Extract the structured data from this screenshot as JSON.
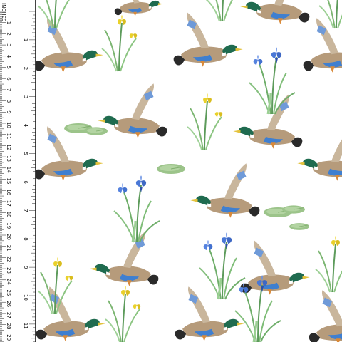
{
  "ruler": {
    "unit_label": "INCHES",
    "inch_labels": [
      "1",
      "2",
      "3",
      "4",
      "5",
      "6",
      "7",
      "8",
      "9",
      "10",
      "11",
      "12"
    ],
    "cm_labels": [
      "1",
      "2",
      "3",
      "4",
      "5",
      "6",
      "7",
      "8",
      "9",
      "10",
      "11",
      "12",
      "13",
      "14",
      "15",
      "16",
      "17",
      "18",
      "19",
      "20",
      "21",
      "22",
      "23",
      "24",
      "25",
      "26",
      "27",
      "28",
      "29",
      "30"
    ]
  },
  "colors": {
    "background": "#ffffff",
    "mallard_head": "#1f6b4f",
    "duck_body": "#b59a7a",
    "wing_blue": "#3f7fd0",
    "iris_blue": "#4a78d6",
    "iris_yellow": "#e9d12a",
    "reed_green": "#6fae6a",
    "lily_pad": "#9cc48a"
  }
}
